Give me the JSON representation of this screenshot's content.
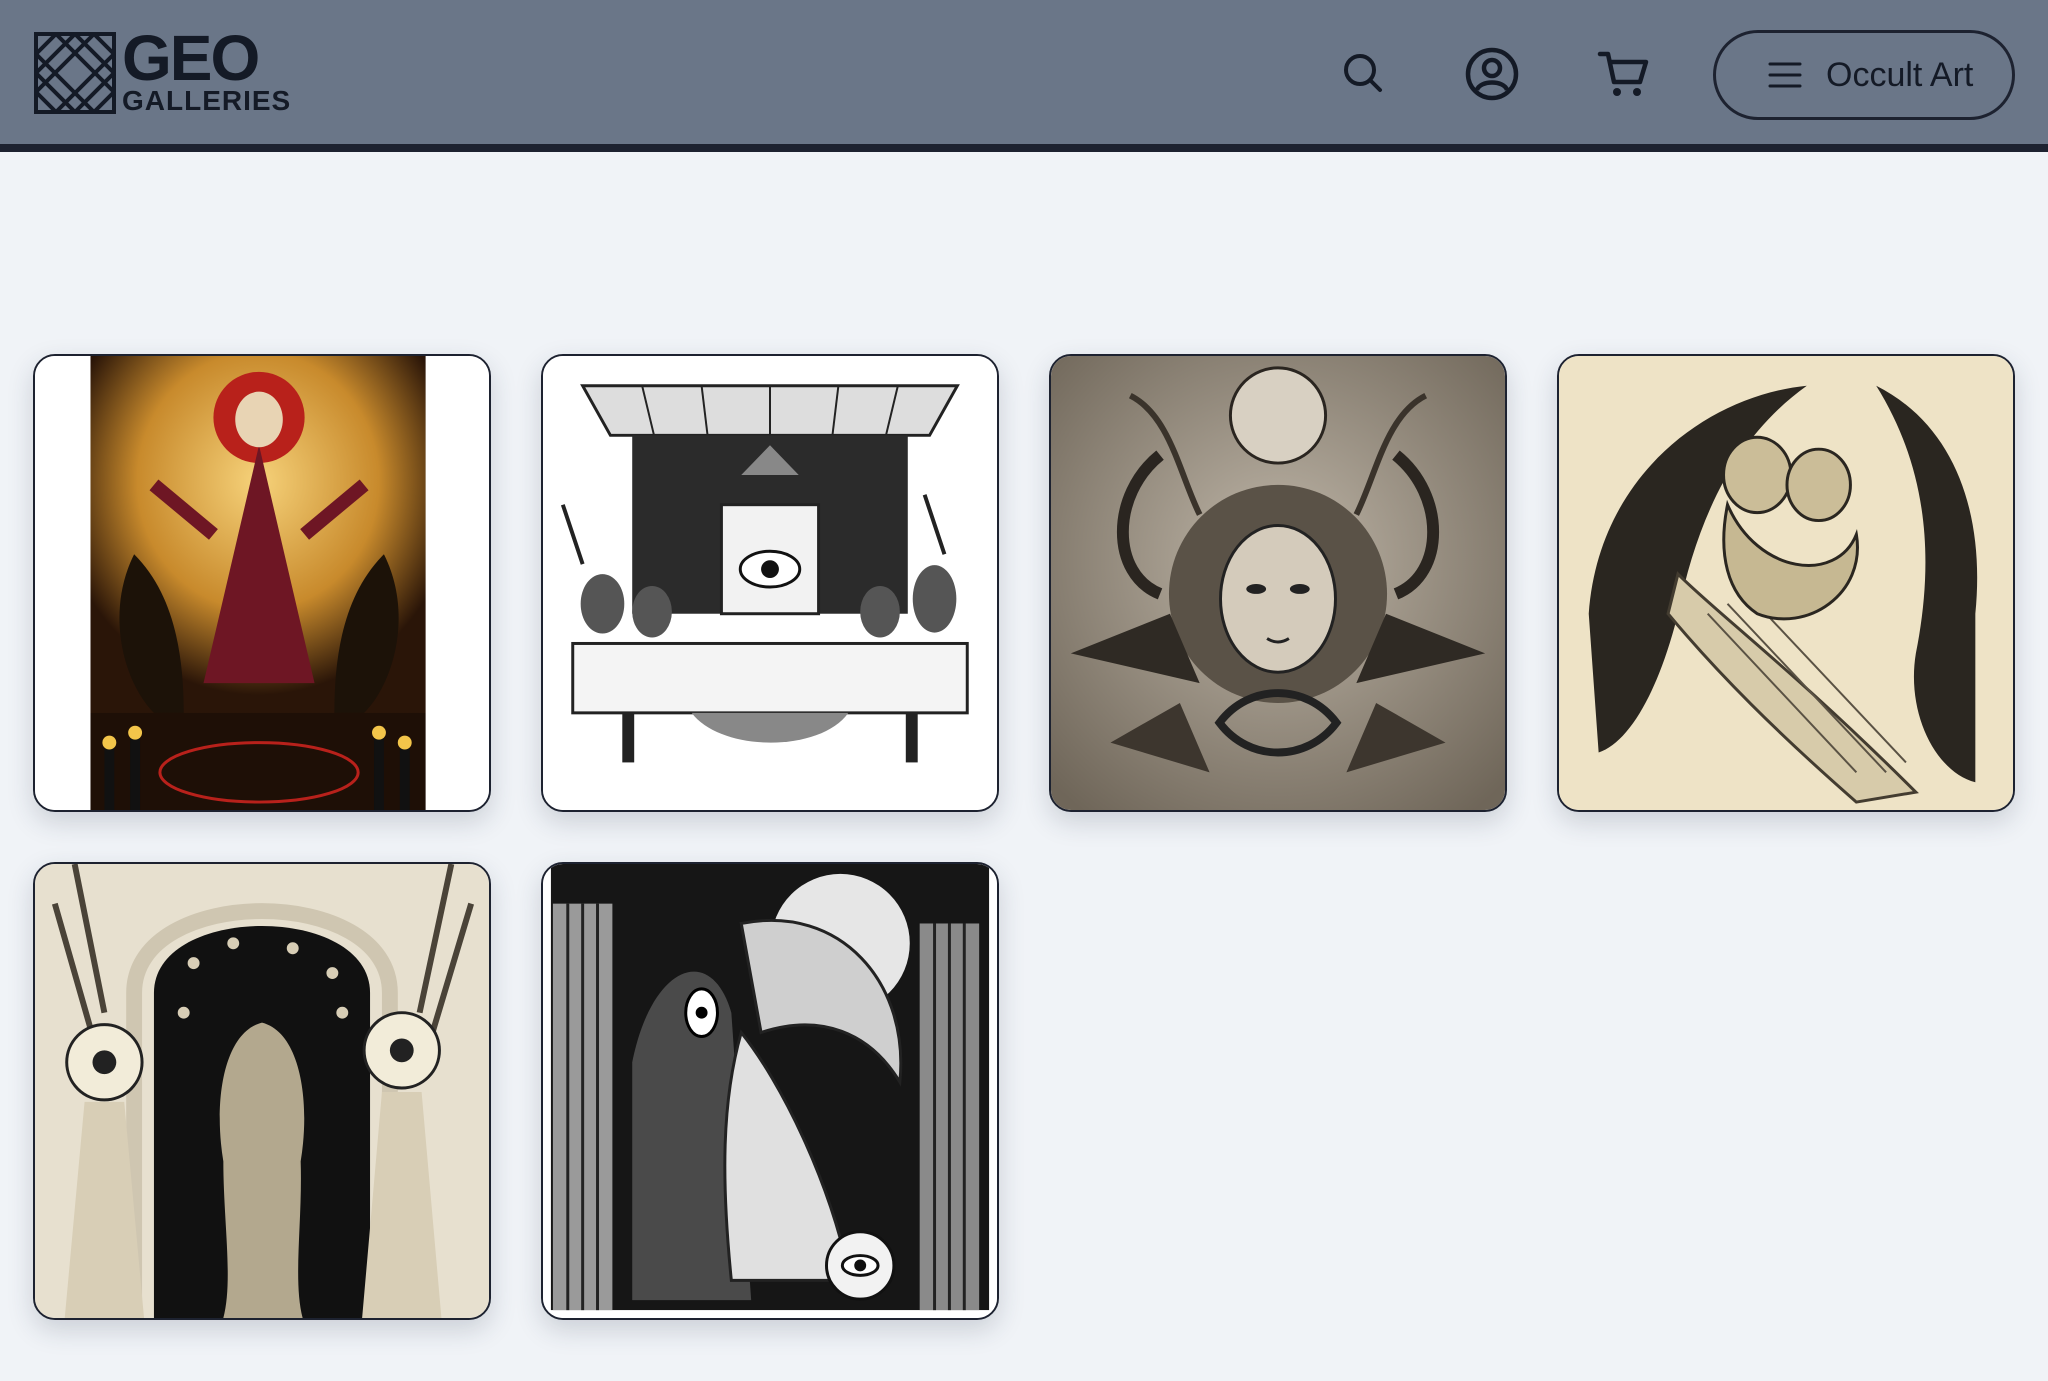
{
  "header": {
    "logo": {
      "line1": "GEO",
      "line2": "GALLERIES"
    },
    "icons": [
      "search-icon",
      "account-icon",
      "cart-icon"
    ],
    "menu": {
      "icon": "hamburger-icon",
      "label": "Occult Art"
    }
  },
  "colors": {
    "header_bg": "#6a7688",
    "header_border": "#1d2230",
    "page_bg": "#f0f3f7",
    "text_dark": "#141a26"
  },
  "gallery": {
    "items": [
      {
        "name": "artwork-robed-ram-figure",
        "subject": "robed ram-headed figure with candles"
      },
      {
        "name": "artwork-last-supper-animals",
        "subject": "animal-headed last supper with eye"
      },
      {
        "name": "artwork-horned-medusa",
        "subject": "horned medusa with serpent and wings"
      },
      {
        "name": "artwork-winged-embrace",
        "subject": "angel and demon embracing"
      },
      {
        "name": "artwork-eyed-trees-arch",
        "subject": "eye-headed figures beneath arch"
      },
      {
        "name": "artwork-angel-reaper",
        "subject": "hooded reaper with weeping angel"
      }
    ]
  }
}
